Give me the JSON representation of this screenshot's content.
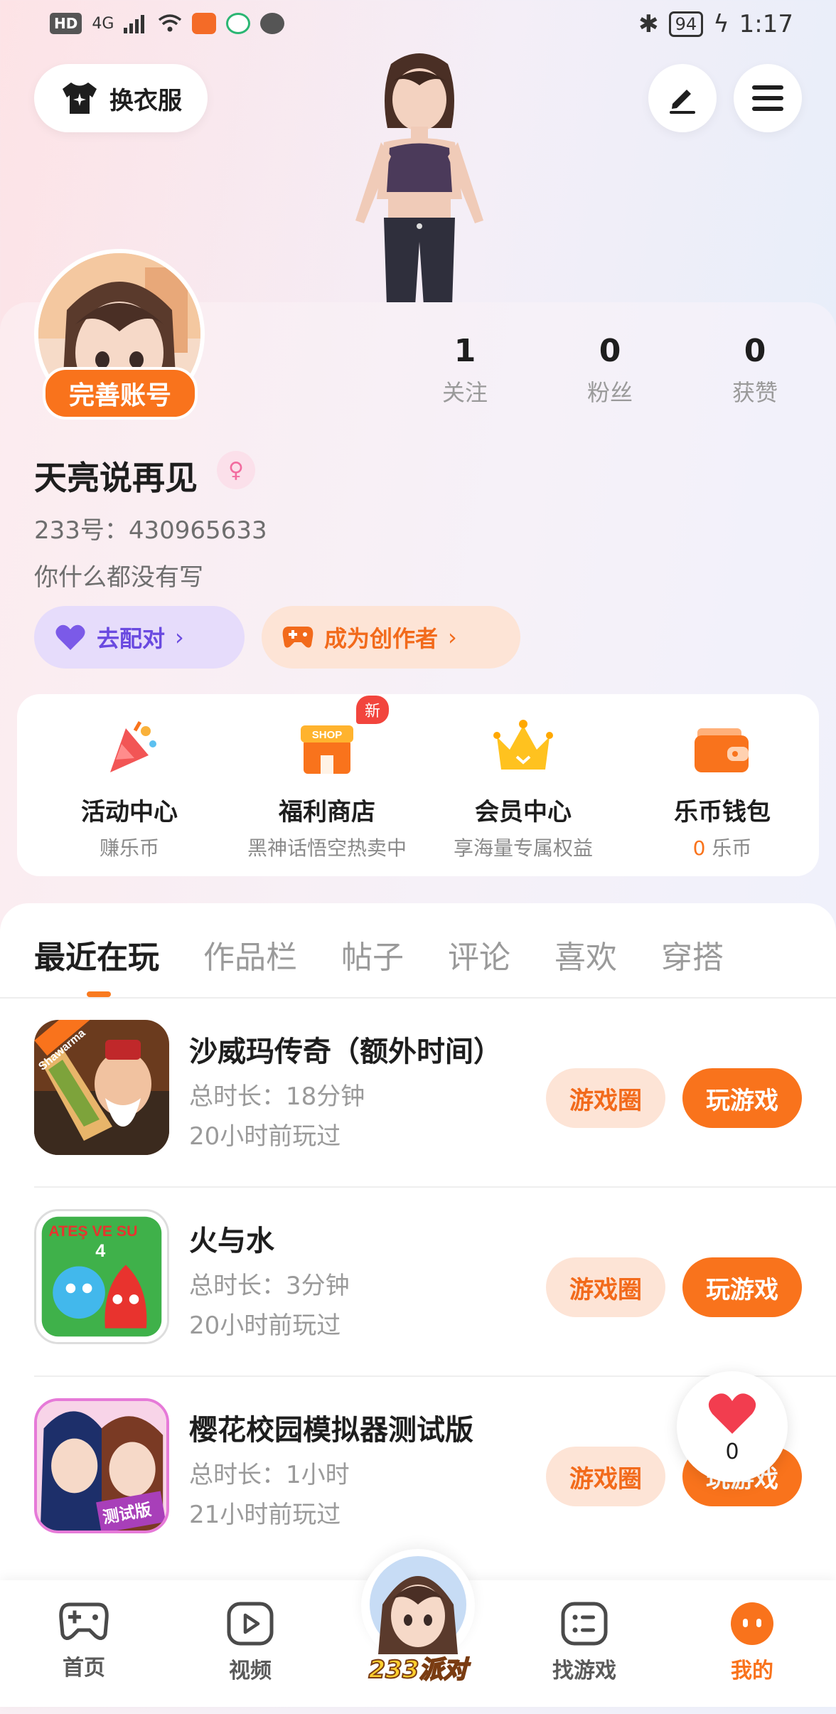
{
  "status_bar": {
    "hd": "HD",
    "network": "4G",
    "battery": "94",
    "time": "1:17"
  },
  "top": {
    "change_clothes_label": "换衣服"
  },
  "profile": {
    "complete_account_label": "完善账号",
    "stats": [
      {
        "value": "1",
        "label": "关注"
      },
      {
        "value": "0",
        "label": "粉丝"
      },
      {
        "value": "0",
        "label": "获赞"
      }
    ],
    "username": "天亮说再见",
    "uid": "233号：430965633",
    "bio": "你什么都没有写",
    "match_label": "去配对",
    "creator_label": "成为创作者"
  },
  "features": [
    {
      "title": "活动中心",
      "subtitle": "赚乐币",
      "icon": "party-popper-icon"
    },
    {
      "title": "福利商店",
      "subtitle": "黑神话悟空热卖中",
      "icon": "shop-icon",
      "badge": "新",
      "shop_text": "SHOP"
    },
    {
      "title": "会员中心",
      "subtitle": "享海量专属权益",
      "icon": "crown-icon"
    },
    {
      "title": "乐币钱包",
      "subtitle_value": "0",
      "subtitle_unit": "乐币",
      "icon": "wallet-icon"
    }
  ],
  "tabs": [
    "最近在玩",
    "作品栏",
    "帖子",
    "评论",
    "喜欢",
    "穿搭"
  ],
  "games": [
    {
      "title": "沙威玛传奇（额外时间）",
      "duration": "总时长：18分钟",
      "last_played": "20小时前玩过",
      "circle_label": "游戏圈",
      "play_label": "玩游戏",
      "icon_text": "Shawarma"
    },
    {
      "title": "火与水",
      "duration": "总时长：3分钟",
      "last_played": "20小时前玩过",
      "circle_label": "游戏圈",
      "play_label": "玩游戏",
      "icon_text": "ATEŞ VE SU",
      "icon_num": "4"
    },
    {
      "title": "樱花校园模拟器测试版",
      "duration": "总时长：1小时",
      "last_played": "21小时前玩过",
      "circle_label": "游戏圈",
      "play_label": "玩游戏",
      "icon_text": "测试版"
    }
  ],
  "like_float": {
    "count": "0"
  },
  "bottom_nav": [
    {
      "label": "首页",
      "icon": "gamepad-icon"
    },
    {
      "label": "视频",
      "icon": "play-icon"
    },
    {
      "label": "233派对",
      "icon": "party-avatar"
    },
    {
      "label": "找游戏",
      "icon": "list-icon"
    },
    {
      "label": "我的",
      "icon": "profile-icon"
    }
  ],
  "colors": {
    "accent": "#f9731c",
    "accent_light": "#fde4d6",
    "purple": "#6a4ae0",
    "purple_light": "#e6dcfb"
  }
}
